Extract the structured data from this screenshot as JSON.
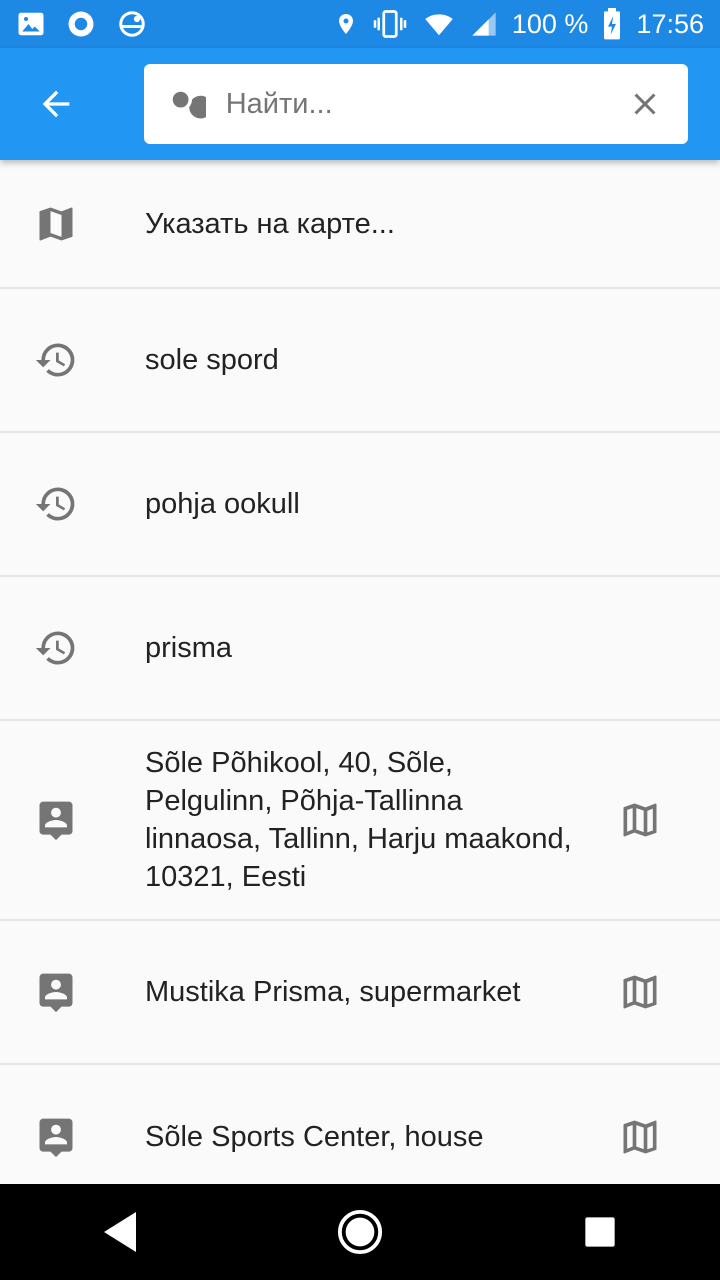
{
  "status_bar": {
    "battery": "100 %",
    "time": "17:56"
  },
  "search": {
    "placeholder": "Найти..."
  },
  "items": [
    {
      "text": "Указать на карте...",
      "icon": "map-icon",
      "has_map_action": false
    },
    {
      "text": "sole spord",
      "icon": "history-icon",
      "has_map_action": false
    },
    {
      "text": "pohja ookull",
      "icon": "history-icon",
      "has_map_action": false
    },
    {
      "text": "prisma",
      "icon": "history-icon",
      "has_map_action": false
    },
    {
      "text": "Sõle Põhikool, 40, Sõle, Pelgulinn, Põhja-Tallinna linnaosa, Tallinn, Harju maakond, 10321, Eesti",
      "icon": "contact-place-icon",
      "has_map_action": true
    },
    {
      "text": "Mustika Prisma, supermarket",
      "icon": "contact-place-icon",
      "has_map_action": true
    },
    {
      "text": "Sõle Sports Center, house",
      "icon": "contact-place-icon",
      "has_map_action": true
    }
  ],
  "colors": {
    "status_bar": "#1e88e5",
    "app_bar": "#2196f3",
    "icon_gray": "#757575",
    "background": "#fafafa",
    "nav_bar": "#000000"
  }
}
